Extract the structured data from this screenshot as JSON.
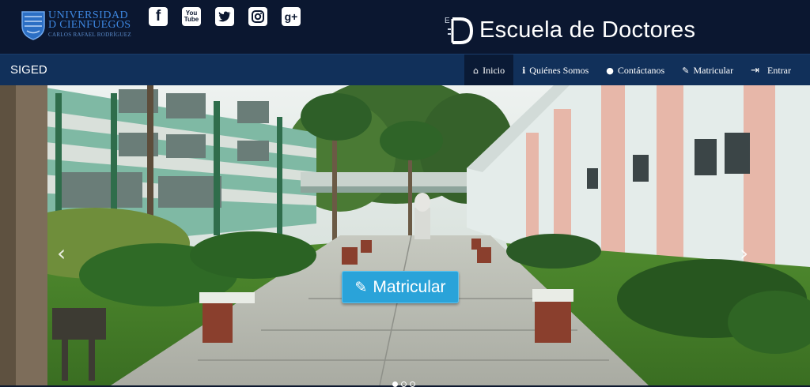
{
  "header": {
    "univ_line1": "UNIVERSIDAD",
    "univ_line2": "D CIENFUEGOS",
    "univ_line3": "CARLOS RAFAEL RODRÍGUEZ",
    "social": [
      {
        "name": "facebook-icon",
        "glyph": "f"
      },
      {
        "name": "youtube-icon",
        "glyph": "You\nTube"
      },
      {
        "name": "twitter-icon",
        "glyph": "🐦"
      },
      {
        "name": "instagram-icon",
        "glyph": "◎"
      },
      {
        "name": "googleplus-icon",
        "glyph": "g+"
      }
    ],
    "brand_title": "Escuela de Doctores"
  },
  "nav": {
    "brand": "SIGED",
    "items": [
      {
        "label": "Inicio",
        "icon": "home-icon",
        "glyph": "⌂"
      },
      {
        "label": "Quiénes Somos",
        "icon": "info-icon",
        "glyph": "ℹ"
      },
      {
        "label": "Contáctanos",
        "icon": "comment-icon",
        "glyph": "💬"
      },
      {
        "label": "Matricular",
        "icon": "pencil-icon",
        "glyph": "✎"
      },
      {
        "label": "Entrar",
        "icon": "login-icon",
        "glyph": "⇥"
      }
    ]
  },
  "hero": {
    "cta_label": "Matricular",
    "prev_glyph": "‹",
    "next_glyph": "›"
  },
  "colors": {
    "topbar": "#0b1730",
    "navbar": "#11305a",
    "accent": "#2aa3d9"
  }
}
